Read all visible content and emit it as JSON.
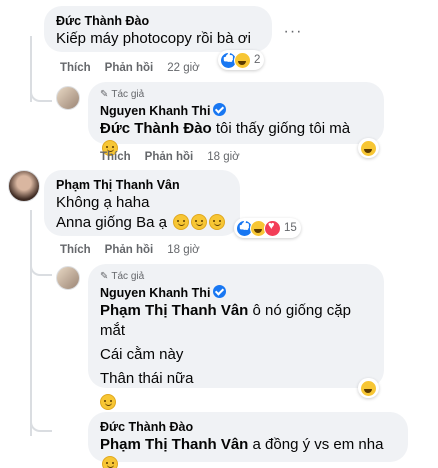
{
  "comments": [
    {
      "author": "Đức Thành Đào",
      "text": "Kiếp máy photocopy rồi bà ơi",
      "actions": {
        "like": "Thích",
        "reply": "Phản hồi",
        "time": "22 giờ"
      },
      "reactions": {
        "icons": [
          "like-icon",
          "haha-icon"
        ],
        "count": "2"
      }
    },
    {
      "badge": "Tác giả",
      "author": "Nguyen Khanh Thi",
      "mention": "Đức Thành Đào",
      "text": "tôi thấy giống tôi mà",
      "actions": {
        "like": "Thích",
        "reply": "Phản hồi",
        "time": "18 giờ"
      },
      "reactions": {
        "icons": [
          "haha-icon"
        ]
      }
    },
    {
      "author": "Phạm Thị Thanh Vân",
      "line1": "Không ạ haha",
      "line2": "Anna giống Ba ạ",
      "actions": {
        "like": "Thích",
        "reply": "Phản hồi",
        "time": "18 giờ"
      },
      "reactions": {
        "icons": [
          "like-icon",
          "haha-icon",
          "love-icon"
        ],
        "count": "15"
      }
    },
    {
      "badge": "Tác giả",
      "author": "Nguyen Khanh Thi",
      "mention": "Phạm Thị Thanh Vân",
      "line1": "ô nó giống cặp mắt",
      "line2": "Cái cằm này",
      "line3": "Thân thái nữa",
      "reactions": {
        "icons": [
          "haha-icon"
        ]
      }
    },
    {
      "author": "Đức Thành Đào",
      "mention": "Phạm Thị Thanh Vân",
      "text": "a đồng ý vs em nha"
    }
  ],
  "colors": {
    "bubble": "#f0f2f5",
    "meta": "#65676b",
    "like": "#1877f2",
    "haha": "#f7c634",
    "love": "#f33e58"
  }
}
